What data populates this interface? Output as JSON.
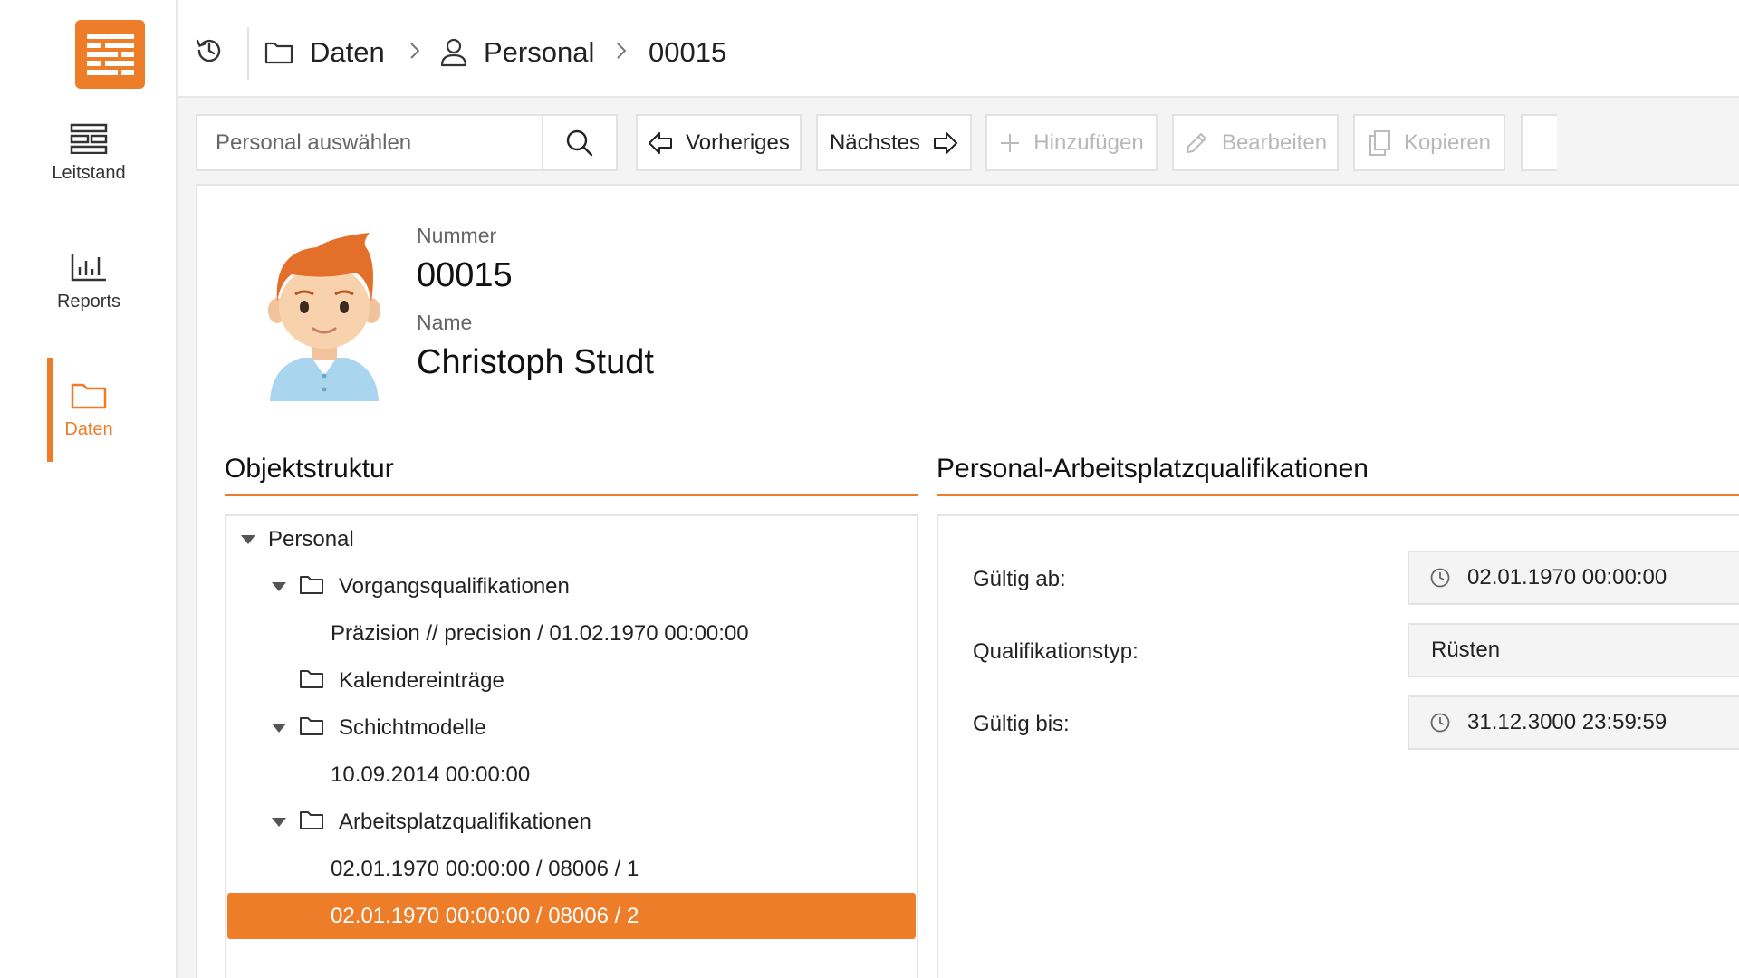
{
  "sidebar": {
    "items": [
      {
        "label": "Leitstand",
        "icon": "dashboard-icon"
      },
      {
        "label": "Reports",
        "icon": "bar-chart-icon"
      },
      {
        "label": "Daten",
        "icon": "folder-icon",
        "active": true
      }
    ],
    "accent_color": "#ee7d2a"
  },
  "header": {
    "breadcrumb": [
      {
        "label": "Daten",
        "icon": "folder-icon"
      },
      {
        "label": "Personal",
        "icon": "user-icon"
      },
      {
        "label": "00015"
      }
    ]
  },
  "toolbar": {
    "search_placeholder": "Personal auswählen",
    "prev_label": "Vorheriges",
    "next_label": "Nächstes",
    "add_label": "Hinzufügen",
    "edit_label": "Bearbeiten",
    "copy_label": "Kopieren"
  },
  "record": {
    "number_label": "Nummer",
    "number": "00015",
    "name_label": "Name",
    "name": "Christoph Studt"
  },
  "tree": {
    "title": "Objektstruktur",
    "rows": [
      {
        "label": "Personal"
      },
      {
        "label": "Vorgangsqualifikationen"
      },
      {
        "label": "Präzision // precision / 01.02.1970 00:00:00"
      },
      {
        "label": "Kalendereinträge"
      },
      {
        "label": "Schichtmodelle"
      },
      {
        "label": "10.09.2014 00:00:00"
      },
      {
        "label": "Arbeitsplatzqualifikationen"
      },
      {
        "label": "02.01.1970 00:00:00 / 08006 / 1"
      },
      {
        "label": "02.01.1970 00:00:00 / 08006 / 2",
        "selected": true
      }
    ]
  },
  "detail": {
    "title": "Personal-Arbeitsplatzqualifikationen",
    "fields": [
      {
        "label": "Gültig ab:",
        "value": "02.01.1970 00:00:00"
      },
      {
        "label": "Qualifikationstyp:",
        "value": "Rüsten"
      },
      {
        "label": "Gültig bis:",
        "value": "31.12.3000 23:59:59"
      }
    ]
  }
}
